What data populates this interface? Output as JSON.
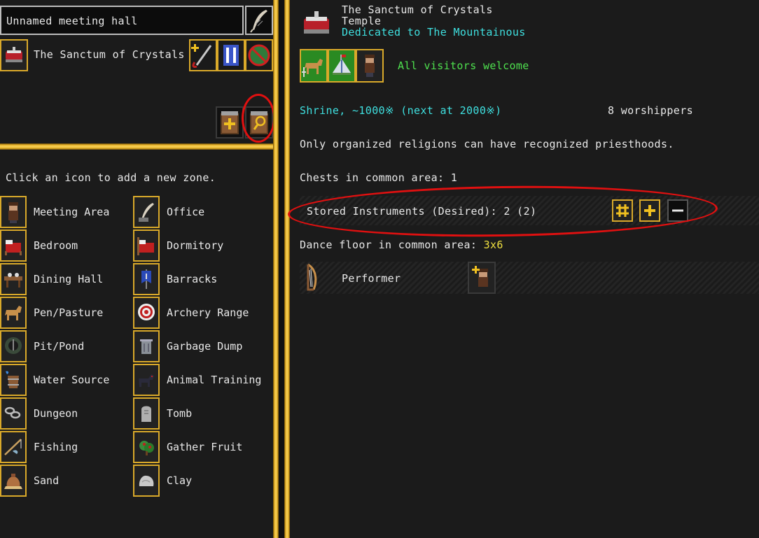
{
  "zone_info": {
    "name_value": "Unnamed meeting hall",
    "location_name": "The Sanctum of Crystals"
  },
  "add_zone": {
    "instruction": "Click an icon to add a new zone.",
    "zones": [
      {
        "label": "Meeting Area",
        "icon": "dwarf-icon"
      },
      {
        "label": "Office",
        "icon": "quill-icon"
      },
      {
        "label": "Bedroom",
        "icon": "bed-icon"
      },
      {
        "label": "Dormitory",
        "icon": "dormitory-bed-icon"
      },
      {
        "label": "Dining Hall",
        "icon": "table-icon"
      },
      {
        "label": "Barracks",
        "icon": "banner-icon"
      },
      {
        "label": "Pen/Pasture",
        "icon": "horse-icon"
      },
      {
        "label": "Archery Range",
        "icon": "target-icon"
      },
      {
        "label": "Pit/Pond",
        "icon": "pit-icon"
      },
      {
        "label": "Garbage Dump",
        "icon": "trash-can-icon"
      },
      {
        "label": "Water Source",
        "icon": "bucket-icon"
      },
      {
        "label": "Animal Training",
        "icon": "dog-icon"
      },
      {
        "label": "Dungeon",
        "icon": "chain-icon"
      },
      {
        "label": "Tomb",
        "icon": "tombstone-icon"
      },
      {
        "label": "Fishing",
        "icon": "fishing-rod-icon"
      },
      {
        "label": "Gather Fruit",
        "icon": "fruit-bush-icon"
      },
      {
        "label": "Sand",
        "icon": "sand-bag-icon"
      },
      {
        "label": "Clay",
        "icon": "clay-lump-icon"
      }
    ]
  },
  "location": {
    "title": "The Sanctum of Crystals",
    "type": "Temple",
    "dedication": "Dedicated to The Mountainous",
    "access": "All visitors welcome",
    "shrine_status": "Shrine, ~1000※ (next at 2000※)",
    "worshippers": "8 worshippers",
    "priesthood_note": "Only organized religions can have recognized priesthoods.",
    "chests": "Chests in common area: 1",
    "instruments": "Stored Instruments (Desired): 2 (2)",
    "dance_floor_label": "Dance floor in common area: ",
    "dance_floor_size": "3x6",
    "position_role": "Performer"
  },
  "colors": {
    "accent_gold": "#e8b42a",
    "cyan_text": "#3fe0e0",
    "green_text": "#4ee04e",
    "yellow_text": "#f0e040",
    "annotation_red": "#e01010"
  }
}
